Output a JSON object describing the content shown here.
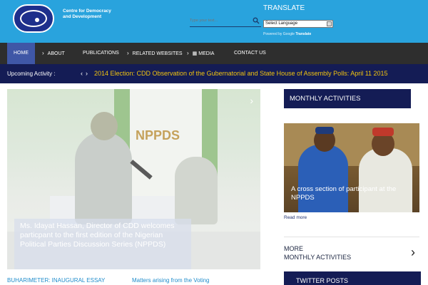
{
  "header": {
    "org_name": "Centre for Democracy and Development",
    "search_placeholder": "Type your text...",
    "translate_title": "TRANSLATE",
    "language_select": "Select Language",
    "powered_prefix": "Powered by Google",
    "powered_link": "Translate"
  },
  "nav": {
    "items": [
      {
        "label": "HOME"
      },
      {
        "label": "ABOUT"
      },
      {
        "label": "PUBLICATIONS"
      },
      {
        "label": "RELATED WEBSITES"
      },
      {
        "label": "MEDIA"
      },
      {
        "label": "CONTACT US"
      }
    ]
  },
  "ticker": {
    "label": "Upcoming Activity :",
    "prev": "‹",
    "next": "›",
    "text": "2014 Election: CDD Observation of the Gubernatorial and State House of Assembly Polls: April 11 2015"
  },
  "slider": {
    "caption": "Ms. Idayat Hassan, Director of CDD welcomes particpant to the first edition of the Nigerian Political Parties Discussion Series (NPPDS)",
    "banner_text": "NPPDS",
    "next": "›"
  },
  "posts": {
    "left": "BUHARIMETER: INAUGURAL ESSAY",
    "right": "Matters arising from the Voting"
  },
  "sidebar": {
    "monthly_title": "MONTHLY ACTIVITIES",
    "photo_caption": "A cross section of participant at the NPPDS",
    "read_more": "Read more",
    "more_label_1": "MORE",
    "more_label_2": "MONTHLY ACTIVITIES",
    "more_arrow": "›",
    "twitter_title": "TWITTER POSTS"
  },
  "colors": {
    "header_bg": "#29a3dd",
    "nav_bg": "#2e2e2e",
    "nav_active": "#3f57a6",
    "ticker_bg": "#141c55",
    "ticker_text": "#f1c40f",
    "link": "#1f8ccb"
  }
}
